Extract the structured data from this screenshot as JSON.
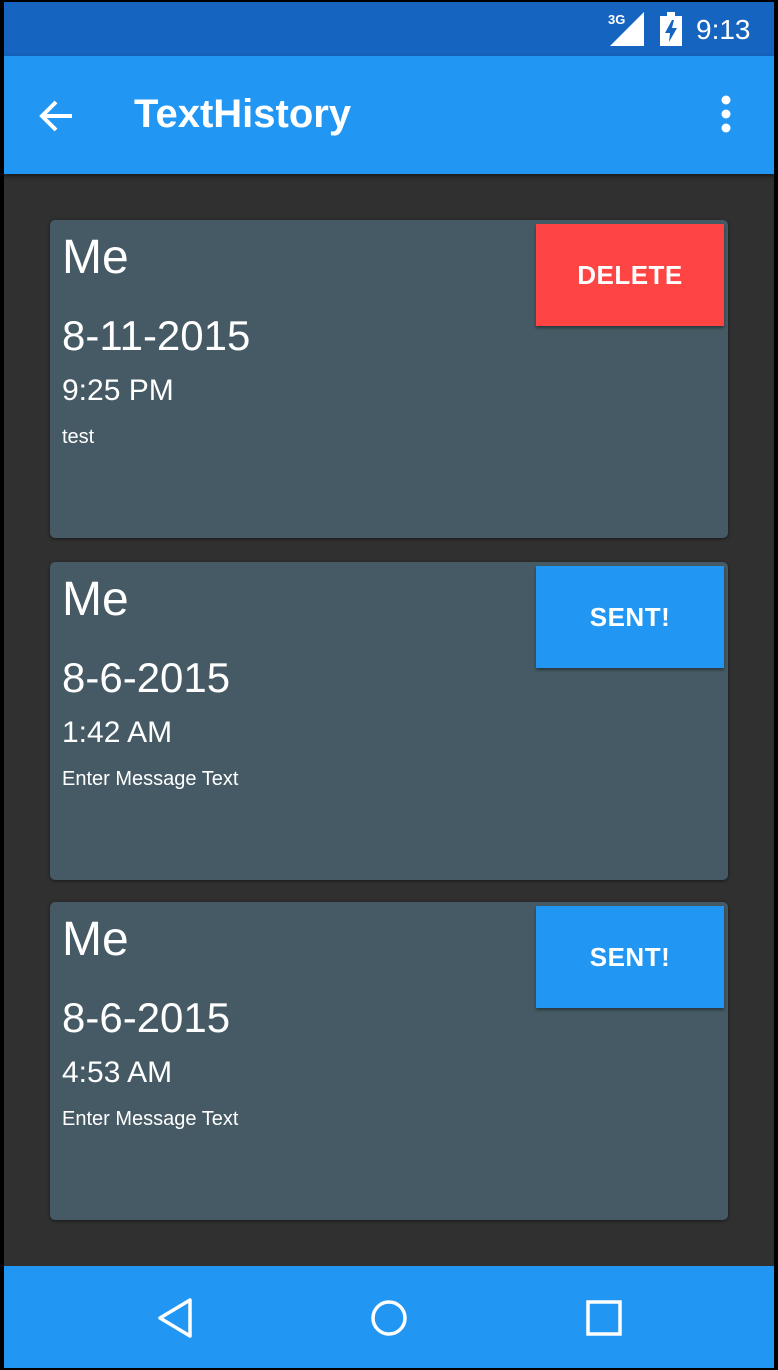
{
  "colors": {
    "status_bar": "#1565c0",
    "app_bar": "#2196f3",
    "background": "#303030",
    "card": "#455a64",
    "delete_button": "#ff4444",
    "sent_button": "#2196f3",
    "text": "#ffffff"
  },
  "status_bar": {
    "network": "3G",
    "time": "9:13",
    "icons": [
      "signal-icon",
      "battery-charging-icon"
    ]
  },
  "app_bar": {
    "title": "TextHistory",
    "back_icon": "arrow-back-icon",
    "menu_icon": "more-vert-icon"
  },
  "messages": [
    {
      "name": "Me",
      "date": "8-11-2015",
      "time": "9:25 PM",
      "text": "test",
      "action_label": "DELETE",
      "action_color": "#ff4444"
    },
    {
      "name": "Me",
      "date": "8-6-2015",
      "time": "1:42 AM",
      "text": "Enter Message Text",
      "action_label": "SENT!",
      "action_color": "#2196f3"
    },
    {
      "name": "Me",
      "date": "8-6-2015",
      "time": "4:53 AM",
      "text": "Enter Message Text",
      "action_label": "SENT!",
      "action_color": "#2196f3"
    }
  ],
  "nav_bar": {
    "icons": [
      "nav-back-icon",
      "nav-home-icon",
      "nav-recents-icon"
    ]
  }
}
